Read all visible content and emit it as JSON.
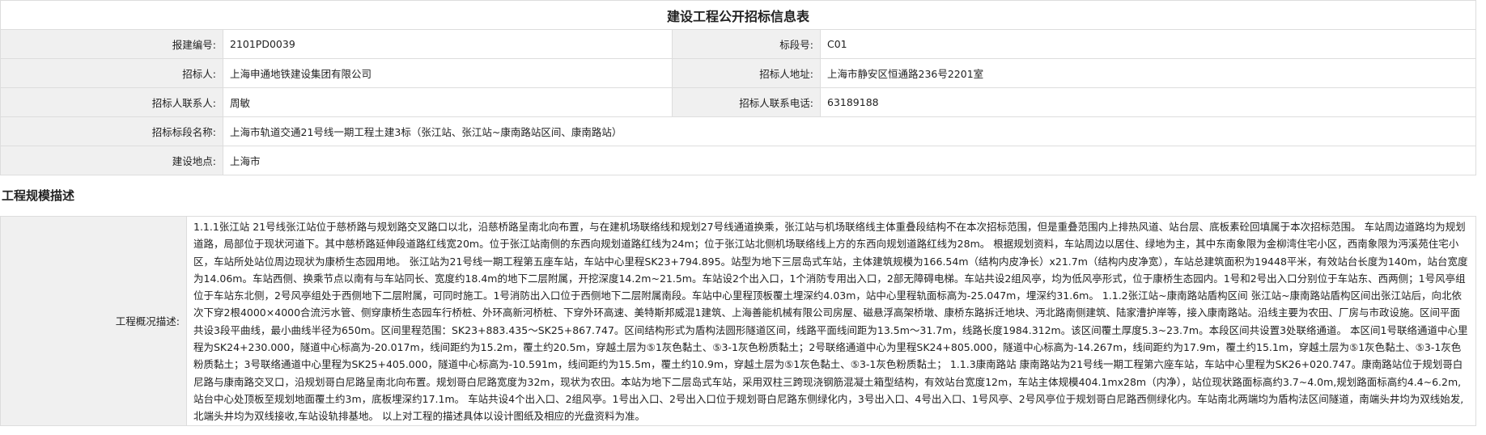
{
  "title": "建设工程公开招标信息表",
  "rows": {
    "project_no": {
      "label": "报建编号:",
      "value": "2101PD0039"
    },
    "section_no": {
      "label": "标段号:",
      "value": "C01"
    },
    "tenderer": {
      "label": "招标人:",
      "value": "上海申通地铁建设集团有限公司"
    },
    "tenderer_address": {
      "label": "招标人地址:",
      "value": "上海市静安区恒通路236号2201室"
    },
    "contact": {
      "label": "招标人联系人:",
      "value": "周敏"
    },
    "phone": {
      "label": "招标人联系电话:",
      "value": "63189188"
    },
    "section_name": {
      "label": "招标标段名称:",
      "value": "上海市轨道交通21号线一期工程土建3标（张江站、张江站~康南路站区间、康南路站）"
    },
    "location": {
      "label": "建设地点:",
      "value": "上海市"
    }
  },
  "scale_heading": "工程规模描述",
  "overview": {
    "label": "工程概况描述:",
    "text": "1.1.1张江站 21号线张江站位于慈桥路与规划路交叉路口以北，沿慈桥路呈南北向布置，与在建机场联络线和规划27号线通道换乘，张江站与机场联络线主体重叠段结构不在本次招标范围，但是重叠范围内上排热风道、站台层、底板素砼回填属于本次招标范围。 车站周边道路均为规划道路，局部位于现状河道下。其中慈桥路延伸段道路红线宽20m。位于张江站南侧的东西向规划道路红线为24m；位于张江站北侧机场联络线上方的东西向规划道路红线为28m。 根据规划资料，车站周边以居住、绿地为主，其中东南象限为金柳湾住宅小区，西南象限为沔溪苑住宅小区，车站所处站位周边现状为康桥生态园用地。 张江站为21号线一期工程第五座车站，车站中心里程SK23+794.895。站型为地下三层岛式车站，主体建筑规模为166.54m（结构内皮净长）x21.7m（结构内皮净宽），车站总建筑面积为19448平米，有效站台长度为140m，站台宽度为14.06m。车站西侧、换乘节点以南有与车站同长、宽度约18.4m的地下二层附属，开挖深度14.2m~21.5m。车站设2个出入口，1个消防专用出入口，2部无障碍电梯。车站共设2组风亭，均为低风亭形式，位于康桥生态园内。1号和2号出入口分别位于车站东、西两侧；1号风亭组位于车站东北侧，2号风亭组处于西侧地下二层附属，可同时施工。1号消防出入口位于西侧地下二层附属南段。车站中心里程顶板覆土埋深约4.03m，站中心里程轨面标高为-25.047m，埋深约31.6m。 1.1.2张江站~康南路站盾构区间 张江站~康南路站盾构区间出张江站后，向北依次下穿2根4000×4000合流污水管、侧穿康桥生态园车行桥桩、外环高新河桥桩、下穿外环高速、美特斯邦威混1建筑、上海善能机械有限公司房屋、磁悬浮高架桥墩、康桥东路拆迁地块、沔北路南侧建筑、陆家漕护岸等，接入康南路站。沿线主要为农田、厂房与市政设施。区间平面共设3段平曲线，最小曲线半径为650m。区间里程范围：SK23+883.435～SK25+867.747。区间结构形式为盾构法圆形隧道区间，线路平面线间距为13.5m～31.7m，线路长度1984.312m。该区间覆土厚度5.3~23.7m。本段区间共设置3处联络通道。 本区间1号联络通道中心里程为SK24+230.000，隧道中心标高为-20.017m，线间距约为15.2m，覆土约20.5m，穿越土层为⑤1灰色黏土、⑤3-1灰色粉质黏土；2号联络通道中心为里程SK24+805.000，隧道中心标高为-14.267m，线间距约为17.9m，覆土约15.1m，穿越土层为⑤1灰色黏土、⑤3-1灰色粉质黏土；3号联络通道中心里程为SK25+405.000，隧道中心标高为-10.591m，线间距约为15.5m，覆土约10.9m，穿越土层为⑤1灰色黏土、⑤3-1灰色粉质黏土； 1.1.3康南路站 康南路站为21号线一期工程第六座车站，车站中心里程为SK26+020.747。康南路站位于规划哥白尼路与康南路交叉口，沿规划哥白尼路呈南北向布置。规划哥白尼路宽度为32m，现状为农田。本站为地下二层岛式车站，采用双柱三跨现浇钢筋混凝土箱型结构，有效站台宽度12m，车站主体规模404.1mx28m（内净），站位现状路面标高约3.7~4.0m,规划路面标高约4.4~6.2m,站台中心处顶板至规划地面覆土约3m，底板埋深约17.1m。 车站共设4个出入口、2组风亭。1号出入口、2号出入口位于规划哥白尼路东侧绿化内，3号出入口、4号出入口、1号风亭、2号风亭位于规划哥白尼路西侧绿化内。车站南北两端均为盾构法区间隧道，南端头井均为双线始发,北端头井均为双线接收,车站设轨排基地。 以上对工程的描述具体以设计图纸及相应的光盘资料为准。"
  }
}
